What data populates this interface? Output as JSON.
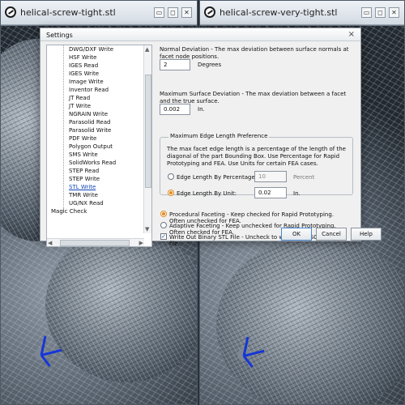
{
  "windows": {
    "left": {
      "title": "helical-screw-tight.stl"
    },
    "right": {
      "title": "helical-screw-very-tight.stl"
    },
    "controls": {
      "minimize": "▭",
      "restore": "◻",
      "close": "✕"
    }
  },
  "dialog": {
    "title": "Settings",
    "close_glyph": "×",
    "tree": {
      "items": [
        "DWG/DXF Write",
        "HSF Write",
        "IGES Read",
        "IGES Write",
        "Image Write",
        "Inventor Read",
        "JT Read",
        "JT Write",
        "NGRAIN Write",
        "Parasolid Read",
        "Parasolid Write",
        "PDF Write",
        "Polygon Output",
        "SMS Write",
        "SolidWorks Read",
        "STEP Read",
        "STEP Write",
        "STL Write",
        "TMR Write",
        "UG/NX Read"
      ],
      "root_item": "Magic Check",
      "selected_index": 17
    },
    "normal_deviation": {
      "label": "Normal Deviation - The max deviation between surface normals at facet node positions.",
      "value": "2",
      "unit": "Degrees"
    },
    "surface_deviation": {
      "label": "Maximum Surface Deviation - The max deviation between a facet and the true surface.",
      "value": "0.002",
      "unit": "In."
    },
    "edge_length": {
      "group_title": "Maximum Edge Length Preference",
      "description": "The max facet edge length is a percentage of the length of the diagonal of the part Bounding Box.  Use Percentage for Rapid Prototyping and FEA.  Use Units for certain FEA cases.",
      "by_percentage": {
        "label": "Edge Length By Percentage:",
        "value": "10",
        "unit": "Percent",
        "checked": false
      },
      "by_unit": {
        "label": "Edge Length By Unit:",
        "value": "0.02",
        "unit": "In.",
        "checked": true
      }
    },
    "faceting": {
      "procedural": {
        "label": "Procedural Faceting - Keep checked for Rapid Prototyping.  Often unchecked for FEA.",
        "checked": true
      },
      "adaptive": {
        "label": "Adaptive Faceting - Keep unchecked for Rapid Prototyping.  Often checked for FEA.",
        "checked": false
      }
    },
    "binary_stl": {
      "label": "Write Out Binary STL File - Uncheck to write out ASCII text STL file.",
      "checked": true,
      "check_glyph": "✓"
    },
    "buttons": {
      "ok": "OK",
      "cancel": "Cancel",
      "help": "Help"
    }
  },
  "icons": {
    "app": "app-logo-icon",
    "tree_expand": "minus-icon",
    "scroll_up": "▲",
    "scroll_down": "▼",
    "scroll_left": "◀",
    "scroll_right": "▶"
  },
  "colors": {
    "dialog_bg": "#f0f0f0",
    "selection": "#1144b8",
    "radio_checked": "#e08a1f",
    "axis_blue": "#1636d6"
  }
}
